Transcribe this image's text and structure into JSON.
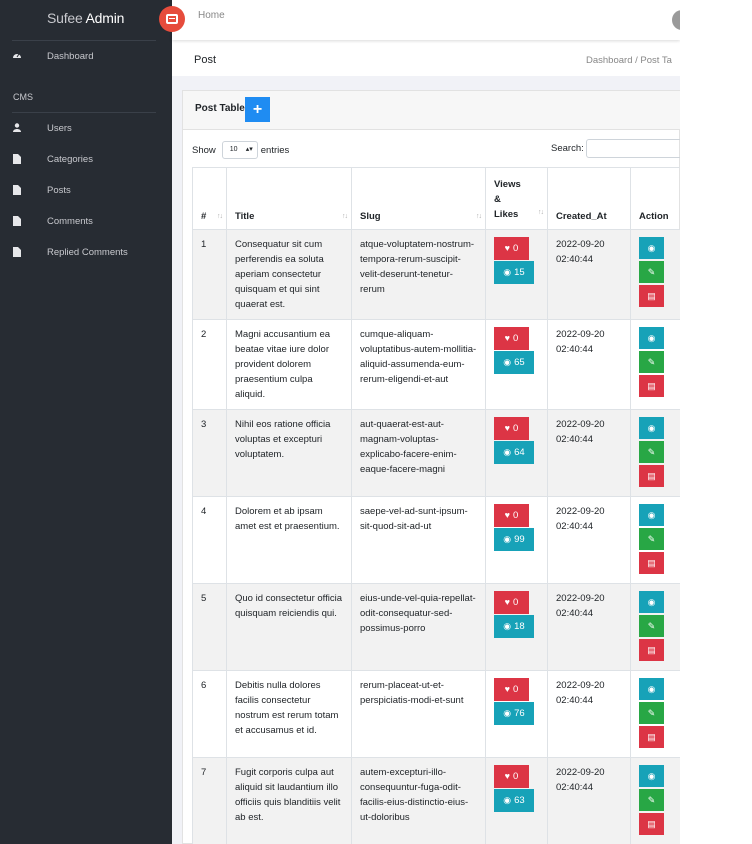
{
  "brand": {
    "prefix": "Sufee",
    "bold": "Admin"
  },
  "header": {
    "home": "Home"
  },
  "sidebar": {
    "dashboard": "Dashboard",
    "section": "CMS",
    "items": [
      {
        "label": "Users",
        "icon": "user-icon"
      },
      {
        "label": "Categories",
        "icon": "file-icon"
      },
      {
        "label": "Posts",
        "icon": "file-icon"
      },
      {
        "label": "Comments",
        "icon": "file-icon"
      },
      {
        "label": "Replied Comments",
        "icon": "file-icon"
      }
    ]
  },
  "page": {
    "title": "Post",
    "breadcrumb_1": "Dashboard /",
    "breadcrumb_2": "Post Ta"
  },
  "card": {
    "title": "Post Table",
    "add_symbol": "+"
  },
  "controls": {
    "show_label": "Show",
    "entries_value": "10",
    "entries_label": "entries",
    "search_label": "Search:"
  },
  "table": {
    "headers": {
      "num": "#",
      "title": "Title",
      "slug": "Slug",
      "views_likes": "Views & Likes",
      "created": "Created_At",
      "action": "Action"
    },
    "rows": [
      {
        "num": "1",
        "title": "Consequatur sit cum perferendis ea soluta aperiam consectetur quisquam et qui sint quaerat est.",
        "slug": "atque-voluptatem-nostrum-tempora-rerum-suscipit-velit-deserunt-tenetur-rerum",
        "likes": "0",
        "views": "15",
        "created": "2022-09-20 02:40:44"
      },
      {
        "num": "2",
        "title": "Magni accusantium ea beatae vitae iure dolor provident dolorem praesentium culpa aliquid.",
        "slug": "cumque-aliquam-voluptatibus-autem-mollitia-aliquid-assumenda-eum-rerum-eligendi-et-aut",
        "likes": "0",
        "views": "65",
        "created": "2022-09-20 02:40:44"
      },
      {
        "num": "3",
        "title": "Nihil eos ratione officia voluptas et excepturi voluptatem.",
        "slug": "aut-quaerat-est-aut-magnam-voluptas-explicabo-facere-enim-eaque-facere-magni",
        "likes": "0",
        "views": "64",
        "created": "2022-09-20 02:40:44"
      },
      {
        "num": "4",
        "title": "Dolorem et ab ipsam amet est et praesentium.",
        "slug": "saepe-vel-ad-sunt-ipsum-sit-quod-sit-ad-ut",
        "likes": "0",
        "views": "99",
        "created": "2022-09-20 02:40:44"
      },
      {
        "num": "5",
        "title": "Quo id consectetur officia quisquam reiciendis qui.",
        "slug": "eius-unde-vel-quia-repellat-odit-consequatur-sed-possimus-porro",
        "likes": "0",
        "views": "18",
        "created": "2022-09-20 02:40:44"
      },
      {
        "num": "6",
        "title": "Debitis nulla dolores facilis consectetur nostrum est rerum totam et accusamus et id.",
        "slug": "rerum-placeat-ut-et-perspiciatis-modi-et-sunt",
        "likes": "0",
        "views": "76",
        "created": "2022-09-20 02:40:44"
      },
      {
        "num": "7",
        "title": "Fugit corporis culpa aut aliquid sit laudantium illo officiis quis blanditiis velit ab est.",
        "slug": "autem-excepturi-illo-consequuntur-fuga-odit-facilis-eius-distinctio-eius-ut-doloribus",
        "likes": "0",
        "views": "63",
        "created": "2022-09-20 02:40:44"
      }
    ]
  },
  "colors": {
    "sidebar_bg": "#272c33",
    "accent_red": "#e64c3c",
    "add_blue": "#1f8cf2",
    "badge_red": "#dc3545",
    "badge_teal": "#17a2b8",
    "edit_green": "#28a745"
  }
}
